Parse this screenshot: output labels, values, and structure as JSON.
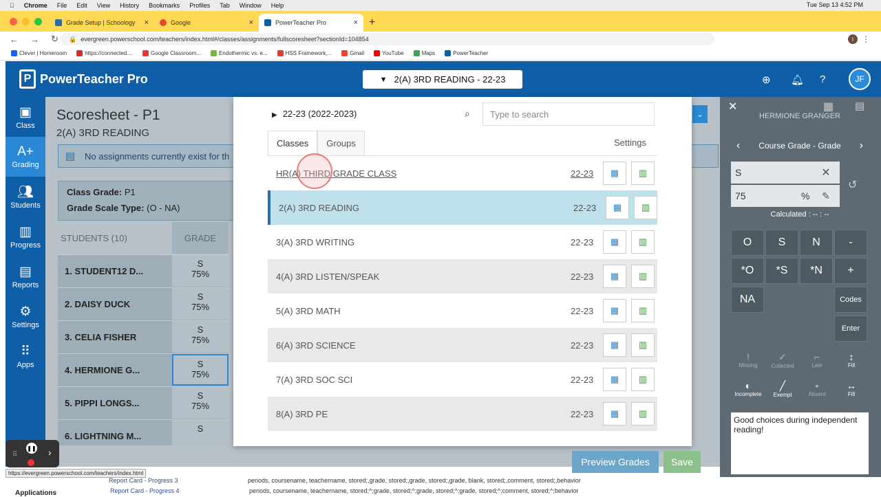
{
  "menubar": {
    "app": "Chrome",
    "items": [
      "File",
      "Edit",
      "View",
      "History",
      "Bookmarks",
      "Profiles",
      "Tab",
      "Window",
      "Help"
    ],
    "datetime": "Tue Sep 13  4:52 PM"
  },
  "tabs": [
    {
      "label": "Grade Setup | Schoology",
      "color": "#2b6cb0"
    },
    {
      "label": "Google",
      "color": "#ea4335"
    },
    {
      "label": "PowerTeacher Pro",
      "color": "#0f5fa8"
    }
  ],
  "address": {
    "url": "evergreen.powerschool.com/teachers/index.html#/classes/assignments/fullscoresheet?sectionId=104854"
  },
  "bookmarks": [
    {
      "label": "Clever | Homeroom",
      "color": "#1464f6"
    },
    {
      "label": "https://connected....",
      "color": "#d32f2f"
    },
    {
      "label": "Google Classroom...",
      "color": "#e53935"
    },
    {
      "label": "Endothermic vs. e...",
      "color": "#7cb342"
    },
    {
      "label": "HSS Framework,...",
      "color": "#e53935"
    },
    {
      "label": "Gmail",
      "color": "#ea4335"
    },
    {
      "label": "YouTube",
      "color": "#ff0000"
    },
    {
      "label": "Maps",
      "color": "#34a853"
    },
    {
      "label": "PowerTeacher",
      "color": "#0f5fa8"
    }
  ],
  "header": {
    "app_name": "PowerTeacher Pro",
    "class_selector": "2(A) 3RD READING - 22-23",
    "avatar": "JF"
  },
  "leftnav": [
    {
      "label": "Class",
      "icon": "class-icon"
    },
    {
      "label": "Grading",
      "icon": "grading-icon",
      "active": true
    },
    {
      "label": "Students",
      "icon": "students-icon"
    },
    {
      "label": "Progress",
      "icon": "progress-icon"
    },
    {
      "label": "Reports",
      "icon": "reports-icon"
    },
    {
      "label": "Settings",
      "icon": "settings-icon"
    },
    {
      "label": "Apps",
      "icon": "apps-icon"
    }
  ],
  "scoresheet": {
    "title": "Scoresheet - P1",
    "subtitle": "2(A) 3RD READING",
    "notice": "No assignments currently exist for th",
    "class_grade_label": "Class Grade:",
    "class_grade_value": "P1",
    "scale_label": "Grade Scale Type:",
    "scale_value": "(O - NA)",
    "students_header": "STUDENTS (10)",
    "grade_header": "GRADE",
    "students": [
      {
        "name": "1.  STUDENT12 D...",
        "grade": "S",
        "pct": "75%"
      },
      {
        "name": "2.  DAISY DUCK",
        "grade": "S",
        "pct": "75%"
      },
      {
        "name": "3.  CELIA FISHER",
        "grade": "S",
        "pct": "75%"
      },
      {
        "name": "4.  HERMIONE G...",
        "grade": "S",
        "pct": "75%"
      },
      {
        "name": "5.  PIPPI LONGS...",
        "grade": "S",
        "pct": "75%"
      },
      {
        "name": "6.  LIGHTNING M...",
        "grade": "S",
        "pct": ""
      }
    ]
  },
  "modal": {
    "year": "22-23 (2022-2023)",
    "search_placeholder": "Type to search",
    "tabs": [
      "Classes",
      "Groups"
    ],
    "settings": "Settings",
    "classes": [
      {
        "name": "HR(A) THIRD GRADE CLASS",
        "year": "22-23"
      },
      {
        "name": "2(A) 3RD READING",
        "year": "22-23"
      },
      {
        "name": "3(A) 3RD WRITING",
        "year": "22-23"
      },
      {
        "name": "4(A) 3RD LISTEN/SPEAK",
        "year": "22-23"
      },
      {
        "name": "5(A) 3RD MATH",
        "year": "22-23"
      },
      {
        "name": "6(A) 3RD SCIENCE",
        "year": "22-23"
      },
      {
        "name": "7(A) 3RD SOC SCI",
        "year": "22-23"
      },
      {
        "name": "8(A) 3RD PE",
        "year": "22-23"
      }
    ]
  },
  "rightpanel": {
    "student": "HERMIONE GRANGER",
    "course": "Course Grade - Grade",
    "grade_input": "S",
    "pct_input": "75",
    "pct_sign": "%",
    "calculated": "Calculated : -- : --",
    "keys": [
      "O",
      "S",
      "N",
      "-",
      "*O",
      "*S",
      "*N",
      "+",
      "NA"
    ],
    "codes": "Codes",
    "enter": "Enter",
    "flags": [
      "Missing",
      "Collected",
      "Late",
      "Fill",
      "Incomplete",
      "Exempt",
      "Absent",
      "Fill"
    ],
    "comment": "Good choices during independent reading!"
  },
  "footer": {
    "preview": "Preview Grades",
    "save": "Save",
    "status_url": "https://evergreen.powerschool.com/teachers/index.html",
    "below1": "Report Card - Progress 3",
    "below2": "Report Card - Progress 4",
    "below_desc1": "periods, coursename, teachername, stored;,grade, stored;,grade, stored;,grade, blank, stored;,comment, stored;,behavior",
    "below_desc2": "periods, coursename, teachername, stored;^;grade, stored;^;grade, stored;^;grade, stored;^;comment, stored;^;behavior",
    "applications": "Applications"
  }
}
